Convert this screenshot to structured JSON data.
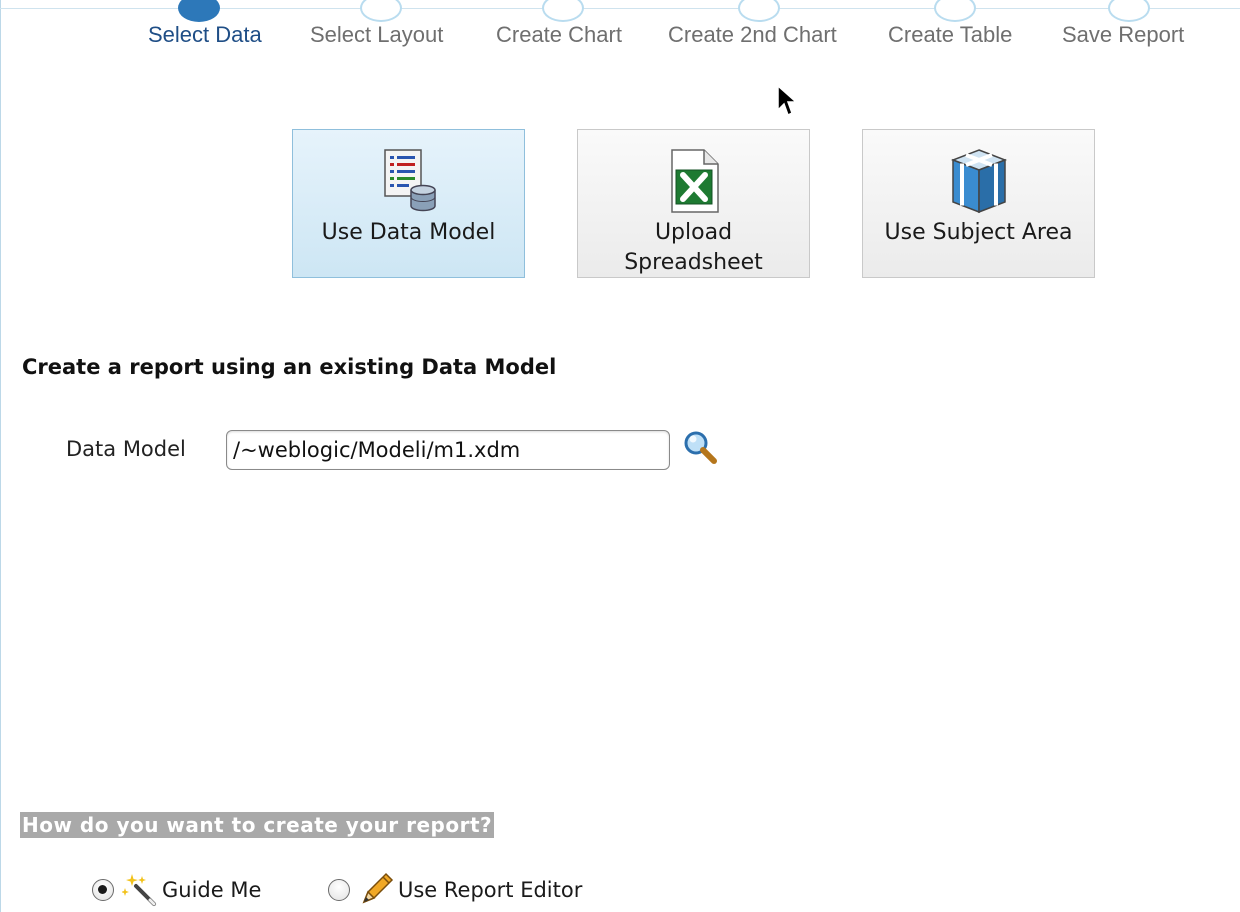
{
  "train": {
    "steps": [
      {
        "label": "Select Data",
        "active": true
      },
      {
        "label": "Select Layout",
        "active": false
      },
      {
        "label": "Create Chart",
        "active": false
      },
      {
        "label": "Create 2nd Chart",
        "active": false
      },
      {
        "label": "Create Table",
        "active": false
      },
      {
        "label": "Save Report",
        "active": false
      }
    ]
  },
  "sources": {
    "data_model": {
      "label": "Use Data Model",
      "icon": "data-model-icon",
      "selected": true
    },
    "spreadsheet": {
      "label": "Upload\nSpreadsheet",
      "icon": "excel-spreadsheet-icon",
      "selected": false
    },
    "subject_area": {
      "label": "Use Subject Area",
      "icon": "subject-area-cube-icon",
      "selected": false
    }
  },
  "section": {
    "title": "Create a report using an existing Data Model"
  },
  "data_model_field": {
    "label": "Data Model",
    "value": "/~weblogic/Modeli/m1.xdm",
    "search_icon": "magnifier-icon"
  },
  "creation_mode": {
    "title": "How do you want to create your report?",
    "options": [
      {
        "label": "Guide Me",
        "icon": "magic-wand-icon",
        "checked": true
      },
      {
        "label": "Use Report Editor",
        "icon": "pencil-icon",
        "checked": false
      }
    ]
  },
  "colors": {
    "accent": "#2d78b9",
    "selected_button_bg": "#cde6f4",
    "highlight_bar": "#a9a9a9"
  }
}
